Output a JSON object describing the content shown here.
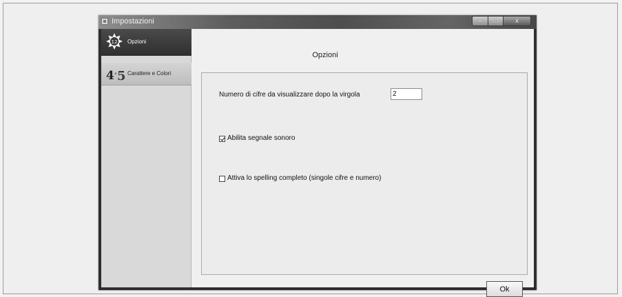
{
  "window": {
    "title": "Impostazioni",
    "caption_buttons": {
      "minimize": "–",
      "maximize": "□",
      "close": "x"
    }
  },
  "sidebar": {
    "items": [
      {
        "label": "Opzioni",
        "icon": "settings-icon",
        "selected": true
      },
      {
        "label": "Carattere e Colori",
        "icon": "font-numbers-icon",
        "selected": false
      }
    ]
  },
  "main": {
    "section_title": "Opzioni",
    "decimals": {
      "label": "Numero di cifre da visualizzare dopo la virgola",
      "value": "2"
    },
    "sound": {
      "label": "Abilita segnale sonoro",
      "checked": true
    },
    "spelling": {
      "label": "Attiva lo spelling completo (singole cifre e numero)",
      "checked": false
    }
  },
  "footer": {
    "ok_label": "Ok"
  }
}
